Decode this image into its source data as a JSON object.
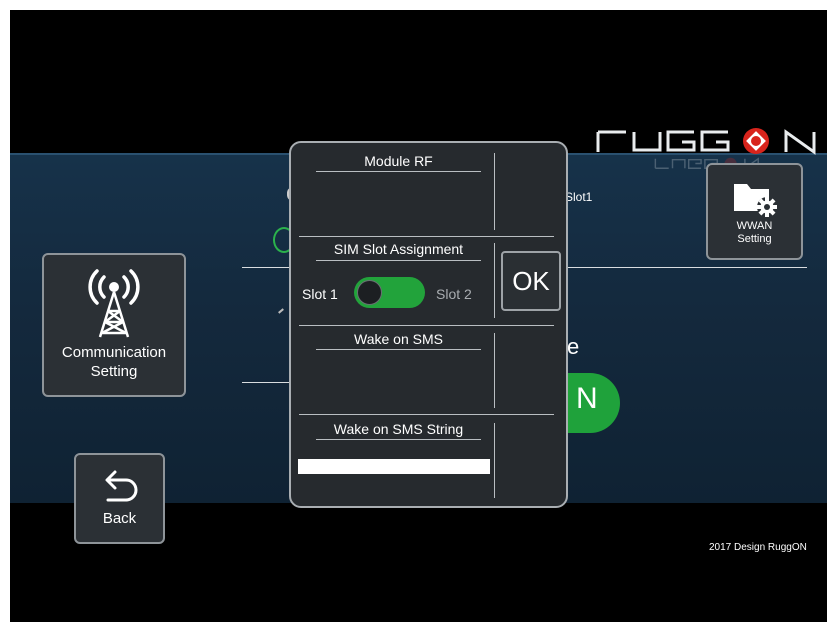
{
  "brand": {
    "logo_text": "RUGGON"
  },
  "background": {
    "slot_text": "Slot1",
    "partial_letter": "e",
    "partial_button_text": "N"
  },
  "tiles": {
    "communication": {
      "label_line1": "Communication",
      "label_line2": "Setting",
      "icon": "antenna-tower-icon"
    },
    "wwan": {
      "label_line1": "WWAN",
      "label_line2": "Setting",
      "icon": "folder-gear-icon"
    },
    "back": {
      "label": "Back",
      "icon": "back-arrow-icon"
    }
  },
  "dialog": {
    "module_rf_title": "Module RF",
    "sim_slot_title": "SIM Slot Assignment",
    "slot1_label": "Slot 1",
    "slot2_label": "Slot 2",
    "toggle_state": "off",
    "ok_label": "OK",
    "wake_sms_title": "Wake on SMS",
    "wake_sms_string_title": "Wake on SMS String",
    "wake_sms_string_value": ""
  },
  "footer": {
    "text": "2017 Design RuggON"
  },
  "colors": {
    "accent_green": "#22a33b",
    "logo_red": "#d8241c",
    "band": "#14293d"
  }
}
